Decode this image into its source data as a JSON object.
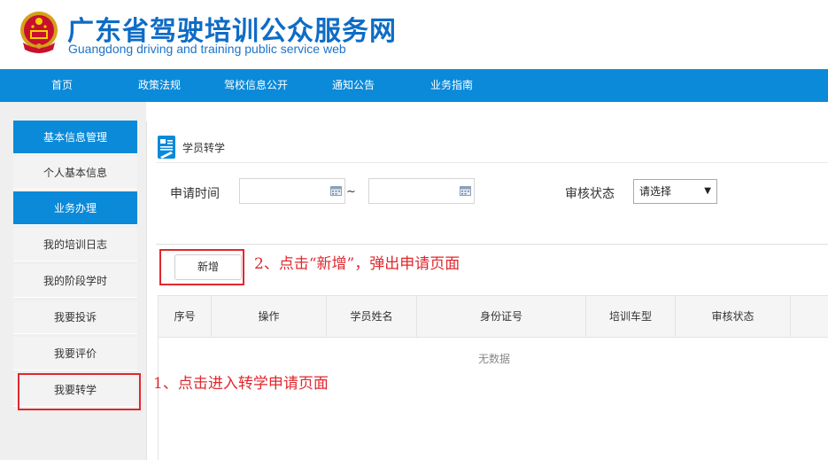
{
  "header": {
    "title": "广东省驾驶培训公众服务网",
    "subtitle": "Guangdong driving and training public service web"
  },
  "nav": {
    "items": [
      {
        "label": "首页"
      },
      {
        "label": "政策法规"
      },
      {
        "label": "驾校信息公开"
      },
      {
        "label": "通知公告"
      },
      {
        "label": "业务指南"
      }
    ]
  },
  "sidebar": {
    "items": [
      {
        "label": "基本信息管理",
        "type": "heading"
      },
      {
        "label": "个人基本信息",
        "type": "item"
      },
      {
        "label": "业务办理",
        "type": "heading"
      },
      {
        "label": "我的培训日志",
        "type": "item"
      },
      {
        "label": "我的阶段学时",
        "type": "item"
      },
      {
        "label": "我要投诉",
        "type": "item"
      },
      {
        "label": "我要评价",
        "type": "item"
      },
      {
        "label": "我要转学",
        "type": "item"
      }
    ]
  },
  "main": {
    "page_title": "学员转学",
    "filters": {
      "apply_time_label": "申请时间",
      "range_separator": "~",
      "start_date_value": "",
      "end_date_value": "",
      "status_label": "审核状态",
      "status_selected": "请选择"
    },
    "new_button_label": "新增",
    "table": {
      "columns": [
        "序号",
        "操作",
        "学员姓名",
        "身份证号",
        "培训车型",
        "审核状态"
      ],
      "empty_message": "无数据"
    }
  },
  "annotations": {
    "step1": "1、点击进入转学申请页面",
    "step2": "2、点击“新增”，弹出申请页面",
    "highlight_color": "#e0282e"
  },
  "colors": {
    "brand_blue": "#0a8ad9",
    "title_blue": "#0e6cc6"
  },
  "icons": {
    "emblem": "national-emblem-icon",
    "page": "form-document-icon",
    "calendar": "calendar-icon",
    "dropdown": "chevron-down-icon"
  }
}
